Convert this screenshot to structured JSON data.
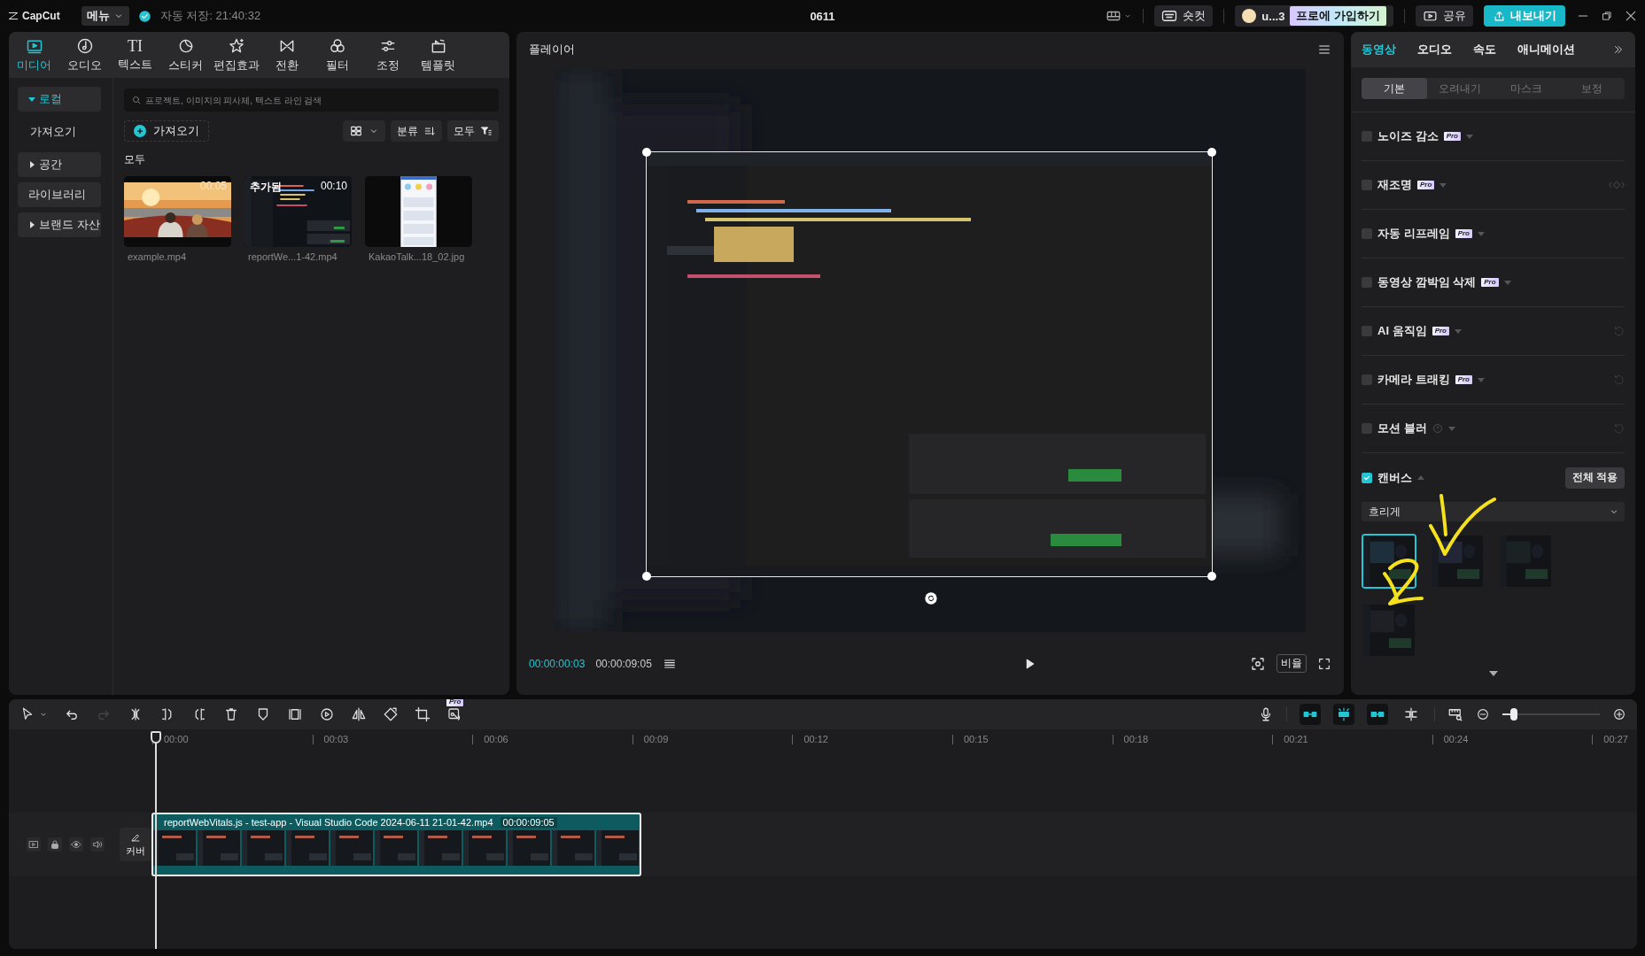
{
  "top_bar": {
    "logo": "CapCut",
    "menu": "메뉴",
    "autosave": "자동 저장: 21:40:32",
    "project_title": "0611",
    "shortcut": "숏컷",
    "user": "u...3",
    "pro_join": "프로에 가입하기",
    "share": "공유",
    "export": "내보내기"
  },
  "media_tabs": [
    {
      "kind": "media",
      "label": "미디어",
      "selected": true
    },
    {
      "kind": "audio",
      "label": "오디오",
      "selected": false
    },
    {
      "kind": "text",
      "glyph": "TI",
      "label": "텍스트",
      "selected": false
    },
    {
      "kind": "sticker",
      "label": "스티커",
      "selected": false
    },
    {
      "kind": "effects",
      "label": "편집효과",
      "selected": false
    },
    {
      "kind": "transition",
      "label": "전환",
      "selected": false
    },
    {
      "kind": "filter",
      "label": "필터",
      "selected": false
    },
    {
      "kind": "adjust",
      "label": "조정",
      "selected": false
    },
    {
      "kind": "template",
      "label": "템플릿",
      "selected": false
    }
  ],
  "media_sidebar": [
    {
      "kind": "group",
      "label": "로컬",
      "expanded": true,
      "selected": true
    },
    {
      "kind": "link",
      "label": "가져오기",
      "selected": false
    },
    {
      "kind": "group",
      "label": "공간",
      "expanded": false,
      "selected": false
    },
    {
      "kind": "box",
      "label": "라이브러리",
      "selected": false
    },
    {
      "kind": "group",
      "label": "브랜드 자산",
      "expanded": false,
      "selected": false
    }
  ],
  "media": {
    "search": {
      "placeholder": "프로젝트, 이미지의 피사체, 텍스트 라인 검색"
    },
    "import": "가져오기",
    "sort": "분류",
    "filter": "모두",
    "section": "모두",
    "items": [
      {
        "name": "example.mp4",
        "duration": "00:05"
      },
      {
        "name": "reportWe...1-42.mp4",
        "duration": "00:10",
        "badge": "추가됨"
      },
      {
        "name": "KakaoTalk...18_02.jpg"
      }
    ]
  },
  "player": {
    "title": "플레이어",
    "current_time": "00:00:00:03",
    "total_time": "00:00:09:05",
    "ratio": "비율"
  },
  "properties": {
    "tabs": [
      {
        "label": "동영상",
        "selected": true
      },
      {
        "label": "오디오",
        "selected": false
      },
      {
        "label": "속도",
        "selected": false
      },
      {
        "label": "애니메이션",
        "selected": false
      }
    ],
    "subtabs": [
      {
        "label": "기본",
        "selected": true
      },
      {
        "label": "오려내기",
        "selected": false
      },
      {
        "label": "마스크",
        "selected": false
      },
      {
        "label": "보정",
        "selected": false
      }
    ],
    "options": [
      {
        "kind": "option",
        "label": "노이즈 감소",
        "checked": false,
        "badge": "Pro"
      },
      {
        "kind": "option",
        "label": "재조명",
        "checked": false,
        "badge": "Pro",
        "keyframes": true
      },
      {
        "kind": "option",
        "label": "자동 리프레임",
        "checked": false,
        "badge": "Pro"
      },
      {
        "kind": "option",
        "label": "동영상 깜박임 삭제",
        "checked": false,
        "badge": "Pro"
      },
      {
        "kind": "option",
        "label": "AI 움직임",
        "checked": false,
        "badge": "Pro",
        "resettable": true
      },
      {
        "kind": "option",
        "label": "카메라 트래킹",
        "checked": false,
        "badge": "Pro",
        "resettable": true
      },
      {
        "kind": "option",
        "label": "모션 블러",
        "checked": false,
        "help": true,
        "resettable": true
      },
      {
        "kind": "canvas",
        "label": "캔버스",
        "checked": true,
        "expanded": true,
        "action": "전체 적용"
      }
    ],
    "canvas_mode": "흐리게",
    "blur_presets": [
      {
        "selected": true
      },
      {
        "selected": false
      },
      {
        "selected": false
      },
      {
        "selected": false
      }
    ]
  },
  "timeline": {
    "toolbar_badge": "Pro",
    "toggles": [
      {
        "on": true
      },
      {
        "on": true
      },
      {
        "on": true
      },
      {
        "on": false
      }
    ],
    "zoom": {
      "level": 0.12
    },
    "ruler": [
      "00:00",
      "00:03",
      "00:06",
      "00:09",
      "00:12",
      "00:15",
      "00:18",
      "00:21",
      "00:24",
      "00:27"
    ],
    "cover": "커버",
    "clip": {
      "title": "reportWebVitals.js - test-app - Visual Studio Code 2024-06-11 21-01-42.mp4",
      "duration": "00:00:09:05"
    }
  }
}
